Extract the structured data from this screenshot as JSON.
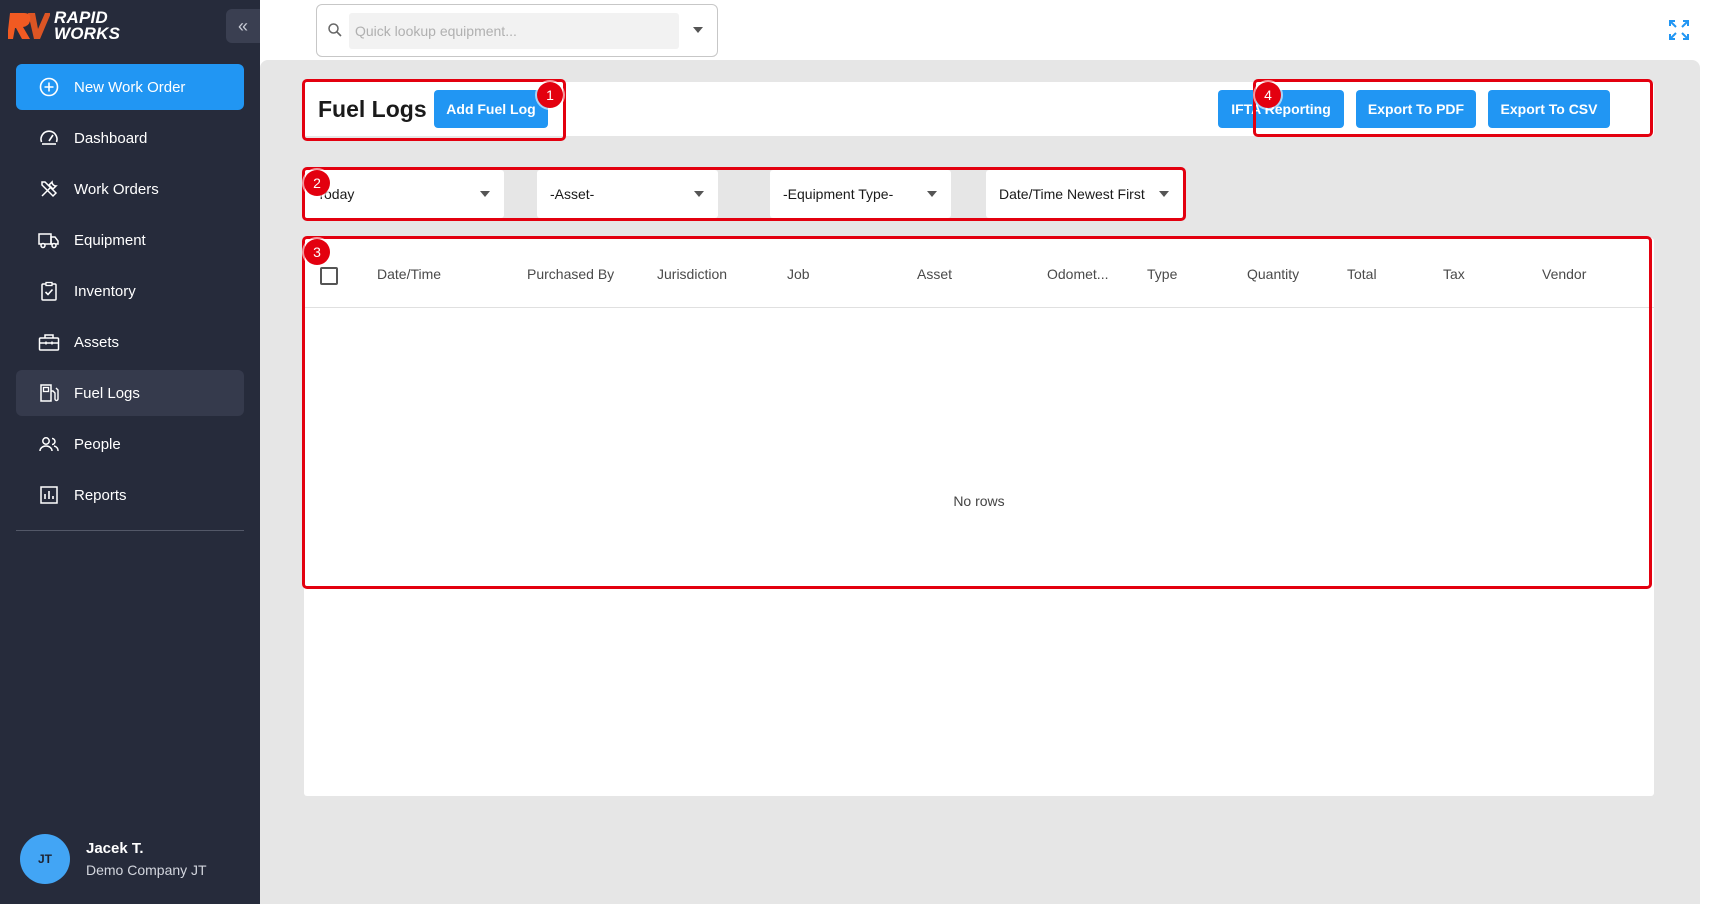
{
  "brand": {
    "line1": "RAPID",
    "line2": "WORKS",
    "accent": "#f15a22"
  },
  "sidebar": {
    "collapse_label": "«",
    "items": [
      {
        "label": "New Work Order",
        "icon": "plus-circle-icon"
      },
      {
        "label": "Dashboard",
        "icon": "speedometer-icon"
      },
      {
        "label": "Work Orders",
        "icon": "tools-icon"
      },
      {
        "label": "Equipment",
        "icon": "truck-icon"
      },
      {
        "label": "Inventory",
        "icon": "clipboard-check-icon"
      },
      {
        "label": "Assets",
        "icon": "toolbox-icon"
      },
      {
        "label": "Fuel Logs",
        "icon": "fuel-pump-icon"
      },
      {
        "label": "People",
        "icon": "people-icon"
      },
      {
        "label": "Reports",
        "icon": "bar-chart-icon"
      }
    ]
  },
  "user": {
    "initials": "JT",
    "name": "Jacek T.",
    "company": "Demo Company JT"
  },
  "search": {
    "placeholder": "Quick lookup equipment..."
  },
  "page": {
    "title": "Fuel Logs",
    "add_button": "Add Fuel Log",
    "ifta_button": "IFTA Reporting",
    "pdf_button": "Export To PDF",
    "csv_button": "Export To CSV"
  },
  "filters": {
    "date": "Today",
    "asset": "-Asset-",
    "equipment_type": "-Equipment Type-",
    "sort": "Date/Time Newest First"
  },
  "table": {
    "columns": [
      "Date/Time",
      "Purchased By",
      "Jurisdiction",
      "Job",
      "Asset",
      "Odomet...",
      "Type",
      "Quantity",
      "Total",
      "Tax",
      "Vendor"
    ],
    "empty_text": "No rows"
  },
  "annotations": [
    "1",
    "2",
    "3",
    "4"
  ],
  "colors": {
    "primary": "#2196f3",
    "sidebar": "#262b3b",
    "annotation": "#e3000f"
  }
}
